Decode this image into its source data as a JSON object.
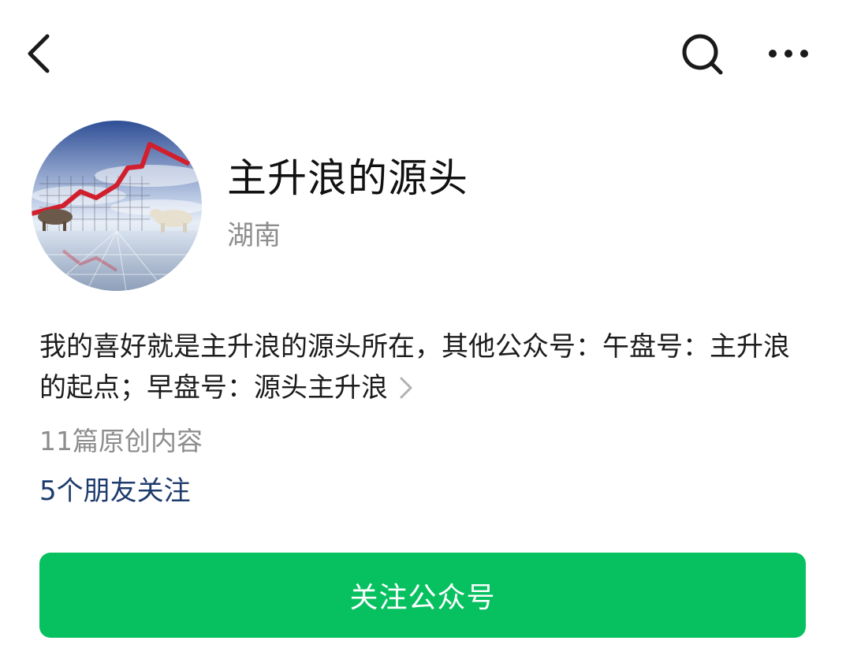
{
  "top_bar": {
    "back_icon": "chevron-left-icon",
    "search_icon": "search-icon",
    "more_icon": "more-horizontal-icon"
  },
  "account": {
    "name": "主升浪的源头",
    "region": "湖南",
    "description": "我的喜好就是主升浪的源头所在，其他公众号：午盘号：主升浪的起点；早盘号：源头主升浪",
    "original_articles": "11篇原创内容",
    "friends_following": "5个朋友关注"
  },
  "follow_button": {
    "label": "关注公众号",
    "color": "#07c160"
  },
  "colors": {
    "friends_link": "#1e3b6e",
    "secondary_text": "#8d8d8d"
  }
}
